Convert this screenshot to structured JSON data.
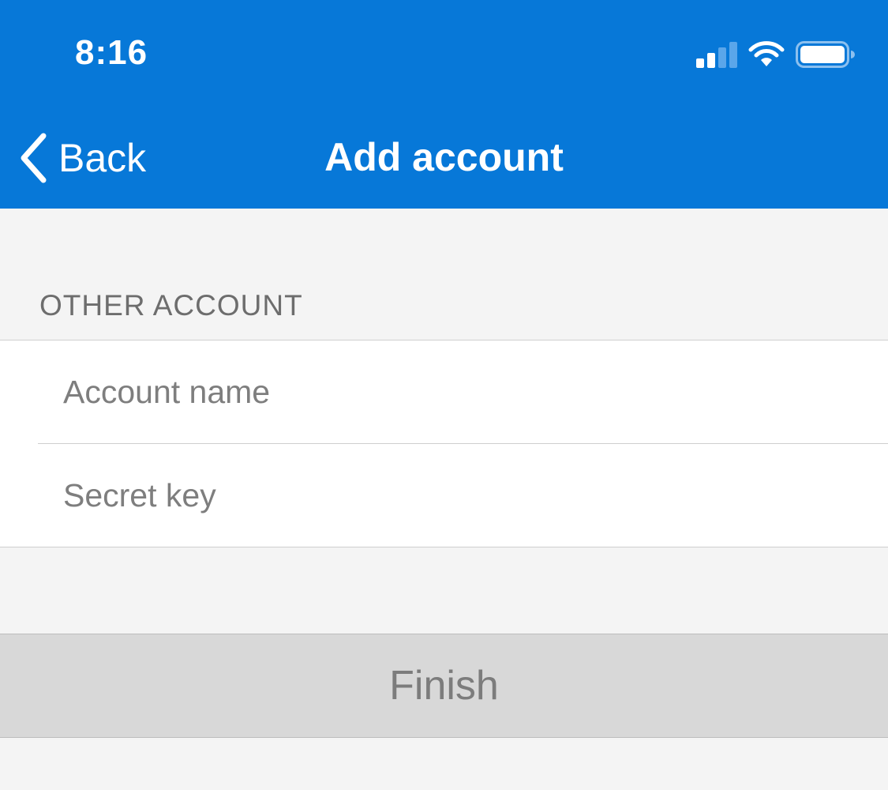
{
  "status_bar": {
    "time": "8:16",
    "icons": [
      "signal-icon",
      "wifi-icon",
      "battery-icon"
    ]
  },
  "nav": {
    "back_label": "Back",
    "title": "Add account"
  },
  "section": {
    "header": "OTHER ACCOUNT"
  },
  "form": {
    "account_name": {
      "value": "",
      "placeholder": "Account name"
    },
    "secret_key": {
      "value": "",
      "placeholder": "Secret key"
    }
  },
  "actions": {
    "finish_label": "Finish",
    "finish_enabled": false
  },
  "colors": {
    "header_bg": "#0778d8",
    "page_bg": "#f4f4f4",
    "disabled_button_bg": "#d8d8d8",
    "disabled_button_text": "#7c7c7c"
  }
}
